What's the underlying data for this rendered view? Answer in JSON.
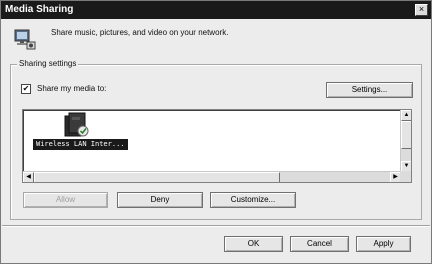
{
  "window": {
    "title": "Media Sharing",
    "close_label": "×"
  },
  "header": {
    "description": "Share music, pictures, and video on your network.",
    "icon": "media-sharing-icon"
  },
  "sharing": {
    "group_label": "Sharing settings",
    "share_checkbox": {
      "label": "Share my media to:",
      "checked": true,
      "mark": "✔"
    },
    "settings_button": "Settings...",
    "devices": [
      {
        "label": "Wireless LAN Inter...",
        "icon": "network-device-icon",
        "selected": true
      }
    ],
    "allow_button": "Allow",
    "deny_button": "Deny",
    "customize_button": "Customize..."
  },
  "scroll": {
    "up": "▲",
    "down": "▼",
    "left": "◀",
    "right": "▶"
  },
  "footer": {
    "ok": "OK",
    "cancel": "Cancel",
    "apply": "Apply"
  }
}
